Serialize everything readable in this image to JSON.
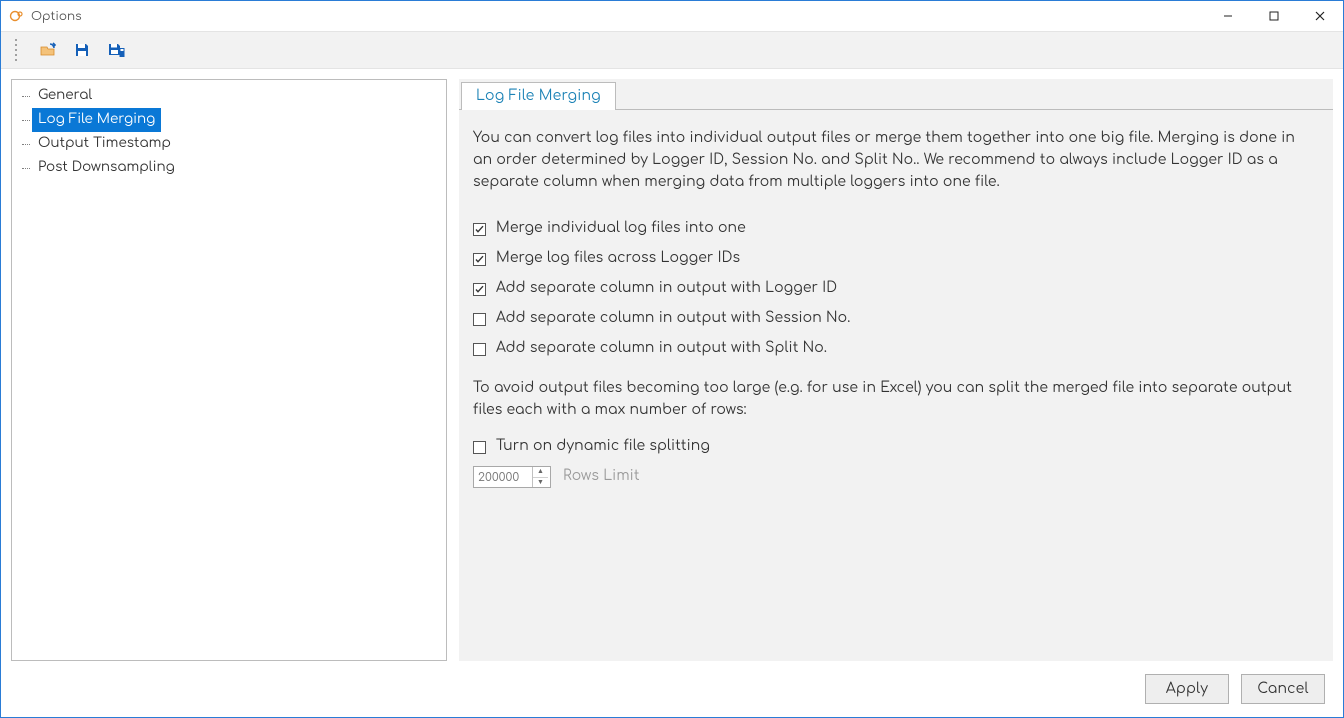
{
  "window": {
    "title": "Options"
  },
  "sidebar": {
    "items": [
      {
        "label": "General",
        "selected": false
      },
      {
        "label": "Log File Merging",
        "selected": true
      },
      {
        "label": "Output Timestamp",
        "selected": false
      },
      {
        "label": "Post Downsampling",
        "selected": false
      }
    ]
  },
  "tab": {
    "label": "Log File Merging"
  },
  "content": {
    "description": "You can convert log files into individual output files or merge them together into one big file. Merging is done in an order determined by Logger ID, Session No. and Split No.. We recommend to always include Logger ID as a separate column when merging data from multiple loggers into one file.",
    "checks": [
      {
        "label": "Merge individual log files into one",
        "checked": true
      },
      {
        "label": "Merge log files across Logger IDs",
        "checked": true
      },
      {
        "label": "Add separate column in output with Logger ID",
        "checked": true
      },
      {
        "label": "Add separate column in output with Session No.",
        "checked": false
      },
      {
        "label": "Add separate column in output with Split No.",
        "checked": false
      }
    ],
    "split_desc": "To avoid output files becoming too large (e.g. for use in Excel) you can split the merged file into separate output files each with a max number of rows:",
    "split_check": {
      "label": "Turn on dynamic file splitting",
      "checked": false
    },
    "rows_limit_value": "200000",
    "rows_limit_label": "Rows Limit"
  },
  "footer": {
    "apply": "Apply",
    "cancel": "Cancel"
  }
}
